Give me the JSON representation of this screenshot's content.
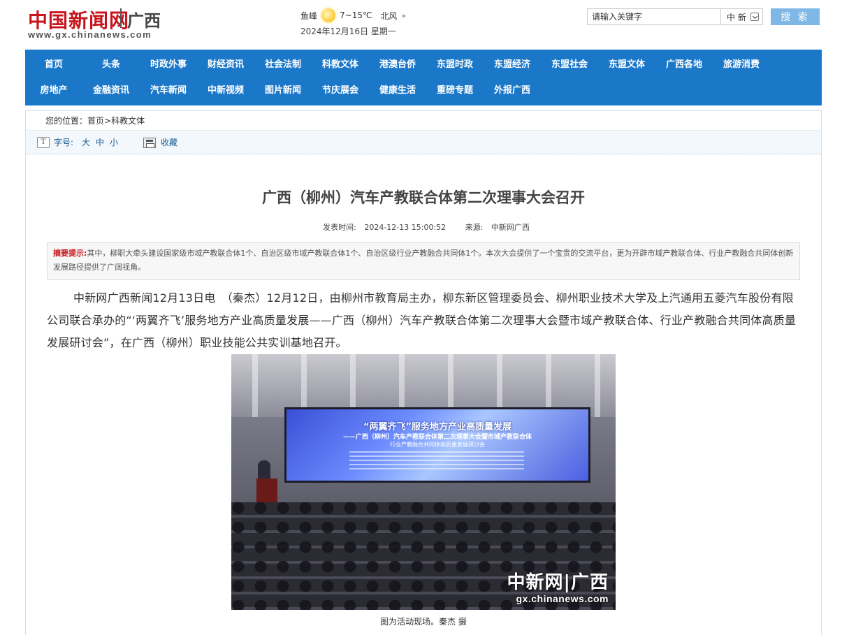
{
  "header": {
    "logo_text": "中国新闻网",
    "logo_region": "广西",
    "logo_domain": "www.gx.chinanews.com",
    "weather": {
      "city": "鱼峰",
      "icon": "sun-icon",
      "temp": "7~15℃",
      "wind": "北风",
      "wind_arrow": "»",
      "date": "2024年12月16日 星期一"
    },
    "search": {
      "placeholder": "请输入关键字",
      "scope": "中 新",
      "button_label": "搜 索"
    }
  },
  "nav": {
    "row1": [
      "首页",
      "头条",
      "时政外事",
      "财经资讯",
      "社会法制",
      "科教文体",
      "港澳台侨",
      "东盟时政",
      "东盟经济",
      "东盟社会",
      "东盟文体",
      "广西各地",
      "旅游消费"
    ],
    "row2": [
      "房地产",
      "金融资讯",
      "汽车新闻",
      "中新视频",
      "图片新闻",
      "节庆展会",
      "健康生活",
      "重磅专题",
      "外报广西"
    ]
  },
  "breadcrumb": {
    "prefix": "您的位置：",
    "home": "首页",
    "sep": ">",
    "section": "科教文体"
  },
  "toolbar": {
    "font_label": "字号:",
    "sizes": [
      "大",
      "中",
      "小"
    ],
    "favorite": "收藏"
  },
  "article": {
    "title": "广西（柳州）汽车产教联合体第二次理事大会召开",
    "publish_label": "发表时间:",
    "publish_time": "2024-12-13 15:00:52",
    "source_label": "来源:",
    "source": "中新网广西",
    "summary_label": "摘要提示:",
    "summary": "其中，柳职大牵头建设国家级市域产教联合体1个、自治区级市域产教联合体1个、自治区级行业产教融合共同体1个。本次大会提供了一个宝贵的交流平台，更为开辟市域产教联合体、行业产教融合共同体创新发展路径提供了广阔视角。",
    "body": "中新网广西新闻12月13日电　（秦杰）12月12日，由柳州市教育局主办，柳东新区管理委员会、柳州职业技术大学及上汽通用五菱汽车股份有限公司联合承办的“‘两翼齐飞’服务地方产业高质量发展——广西（柳州）汽车产教联合体第二次理事大会暨市域产教联合体、行业产教融合共同体高质量发展研讨会”，在广西（柳州）职业技能公共实训基地召开。",
    "photo": {
      "screen_line1": "“两翼齐飞”服务地方产业高质量发展",
      "screen_line2": "——广西（柳州）汽车产教联合体第二次理事大会暨市域产教联合体",
      "screen_line3": "行业产教融合共同体高质量发展研讨会",
      "watermark_cn": "中新网|广西",
      "watermark_domain": "gx.chinanews.com"
    },
    "caption": "图为活动现场。秦杰 摄"
  }
}
